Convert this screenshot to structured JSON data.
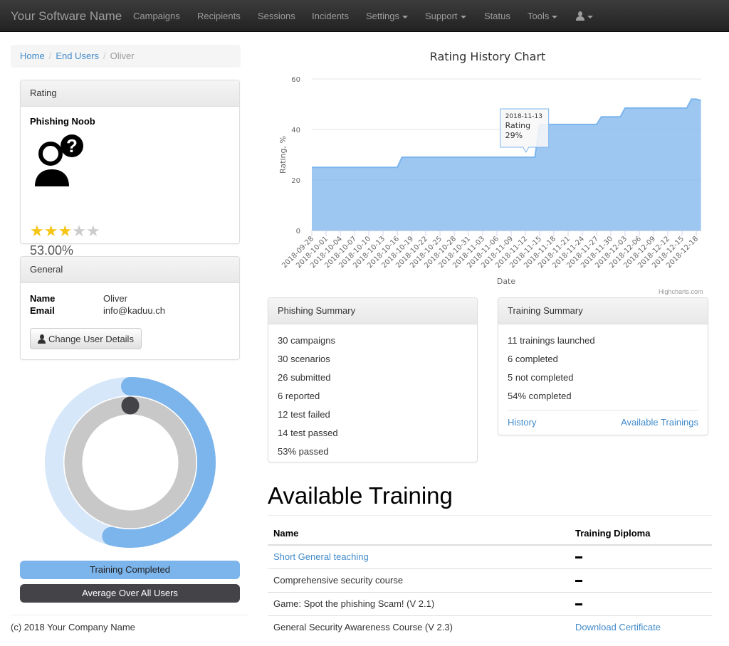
{
  "navbar": {
    "brand": "Your Software Name",
    "items": [
      {
        "label": "Campaigns",
        "dropdown": false
      },
      {
        "label": "Recipients",
        "dropdown": false
      },
      {
        "label": "Sessions",
        "dropdown": false
      },
      {
        "label": "Incidents",
        "dropdown": false
      },
      {
        "label": "Settings",
        "dropdown": true
      },
      {
        "label": "Support",
        "dropdown": true
      },
      {
        "label": "Status",
        "dropdown": false
      },
      {
        "label": "Tools",
        "dropdown": true
      }
    ],
    "user_menu_icon": "user-icon"
  },
  "breadcrumb": {
    "items": [
      {
        "label": "Home",
        "link": true
      },
      {
        "label": "End Users",
        "link": true
      },
      {
        "label": "Oliver",
        "link": false
      }
    ],
    "separator": "/"
  },
  "rating_panel": {
    "heading": "Rating",
    "title": "Phishing Noob",
    "avatar_icon": "user-question-icon",
    "stars_filled": 3,
    "stars_total": 5,
    "percent": "53.00%"
  },
  "general_panel": {
    "heading": "General",
    "fields": [
      {
        "label": "Name",
        "value": "Oliver"
      },
      {
        "label": "Email",
        "value": "info@kaduu.ch"
      }
    ],
    "change_button": "Change User Details"
  },
  "progress_rings": {
    "outer_fraction": 0.54,
    "inner_fraction": 0.0,
    "colors": {
      "outer": "#7cb4ec",
      "outer_track": "#d6e7f9",
      "inner_track": "#c8c8c8",
      "inner_marker": "#434348"
    },
    "legend": [
      {
        "label": "Training Completed",
        "color": "#7cb4ec"
      },
      {
        "label": "Average Over All Users",
        "color": "#434348"
      }
    ]
  },
  "footer": {
    "text": "(c) 2018 Your Company Name"
  },
  "chart_data": {
    "type": "area",
    "title": "Rating History Chart",
    "xlabel": "Date",
    "ylabel": "Rating, %",
    "ylim": [
      0,
      60
    ],
    "yticks": [
      0,
      20,
      40,
      60
    ],
    "grid": true,
    "legend": "none",
    "color": "#7cb4ec",
    "xstart": "2018-09-28",
    "xticks": [
      "2018-09-28",
      "2018-10-01",
      "2018-10-04",
      "2018-10-07",
      "2018-10-10",
      "2018-10-13",
      "2018-10-16",
      "2018-10-19",
      "2018-10-22",
      "2018-10-25",
      "2018-10-28",
      "2018-10-31",
      "2018-11-03",
      "2018-11-06",
      "2018-11-09",
      "2018-11-12",
      "2018-11-15",
      "2018-11-18",
      "2018-11-21",
      "2018-11-24",
      "2018-11-27",
      "2018-11-30",
      "2018-12-03",
      "2018-12-06",
      "2018-12-09",
      "2018-12-12",
      "2018-12-15",
      "2018-12-18"
    ],
    "series": [
      {
        "name": "Rating",
        "points": [
          {
            "x": "2018-09-28",
            "y": 25
          },
          {
            "x": "2018-10-16",
            "y": 25
          },
          {
            "x": "2018-10-17",
            "y": 29
          },
          {
            "x": "2018-11-13",
            "y": 29
          },
          {
            "x": "2018-11-14",
            "y": 29
          },
          {
            "x": "2018-11-15",
            "y": 42
          },
          {
            "x": "2018-11-27",
            "y": 42
          },
          {
            "x": "2018-11-28",
            "y": 45
          },
          {
            "x": "2018-12-02",
            "y": 45
          },
          {
            "x": "2018-12-03",
            "y": 48.5
          },
          {
            "x": "2018-12-16",
            "y": 48.5
          },
          {
            "x": "2018-12-17",
            "y": 52
          },
          {
            "x": "2018-12-18",
            "y": 52
          },
          {
            "x": "2018-12-19",
            "y": 51.5
          }
        ]
      }
    ],
    "tooltip": {
      "date": "2018-11-13",
      "series": "Rating",
      "value": "29%"
    },
    "credits": "Highcharts.com"
  },
  "phishing_summary": {
    "heading": "Phishing Summary",
    "items": [
      "30 campaigns",
      "30 scenarios",
      "26 submitted",
      "6 reported",
      "12 test failed",
      "14 test passed",
      "53% passed"
    ]
  },
  "training_summary": {
    "heading": "Training Summary",
    "items": [
      "11 trainings launched",
      "6 completed",
      "5 not completed",
      "54% completed"
    ],
    "links": {
      "history": "History",
      "available": "Available Trainings"
    }
  },
  "available_training": {
    "heading": "Available Training",
    "columns": [
      "Name",
      "Training Diploma"
    ],
    "rows": [
      {
        "name": "Short General teaching",
        "name_link": true,
        "diploma": "",
        "diploma_link": false
      },
      {
        "name": "Comprehensive security course",
        "name_link": false,
        "diploma": "",
        "diploma_link": false
      },
      {
        "name": "Game: Spot the phishing Scam! (V 2.1)",
        "name_link": false,
        "diploma": "",
        "diploma_link": false
      },
      {
        "name": "General Security Awareness Course (V 2.3)",
        "name_link": false,
        "diploma": "Download Certificate",
        "diploma_link": true
      }
    ]
  }
}
